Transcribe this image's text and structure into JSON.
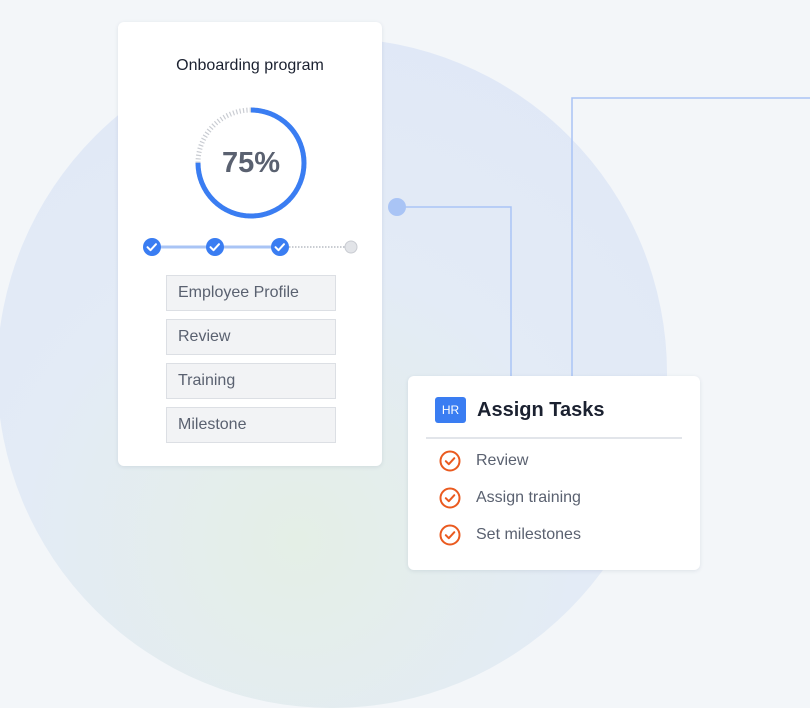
{
  "onboarding": {
    "title": "Onboarding program",
    "progress_text": "75%",
    "progress_fraction": 0.75,
    "steps_completed": 3,
    "steps_total": 4,
    "items": [
      "Employee Profile",
      "Review",
      "Training",
      "Milestone"
    ]
  },
  "tasks": {
    "badge": "HR",
    "title": "Assign Tasks",
    "items": [
      "Review",
      "Assign training",
      "Set milestones"
    ]
  },
  "colors": {
    "accent": "#3a7df2",
    "check_orange": "#ea5a1f",
    "connector": "#a9c4f5"
  },
  "icons": {
    "step_done": "check-circle-icon",
    "step_pending": "dot-icon",
    "task_item": "check-circle-outline-icon"
  }
}
